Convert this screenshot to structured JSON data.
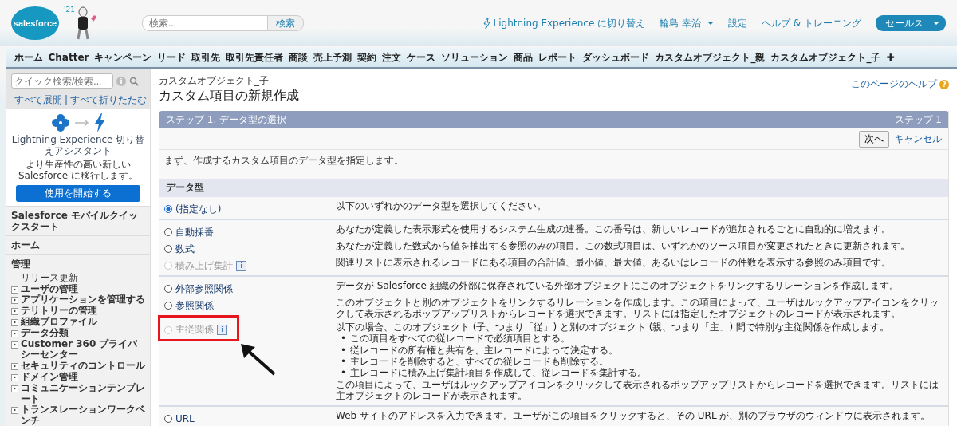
{
  "header": {
    "logo": "salesforce",
    "mascot_year": "'21",
    "search": {
      "placeholder": "検索...",
      "button": "検索"
    },
    "links": [
      {
        "text": "Lightning Experience に切り替え",
        "kind": "lightning"
      },
      {
        "text": "輪島 幸治",
        "kind": "user"
      },
      {
        "text": "設定",
        "kind": "plain"
      },
      {
        "text": "ヘルプ & トレーニング",
        "kind": "plain"
      }
    ],
    "app_menu": "セールス"
  },
  "tabs": [
    {
      "label": "ホーム",
      "selected": false
    },
    {
      "label": "Chatter",
      "selected": false
    },
    {
      "label": "キャンペーン",
      "selected": false
    },
    {
      "label": "リード",
      "selected": false
    },
    {
      "label": "取引先",
      "selected": false
    },
    {
      "label": "取引先責任者",
      "selected": false
    },
    {
      "label": "商談",
      "selected": false
    },
    {
      "label": "売上予測",
      "selected": false
    },
    {
      "label": "契約",
      "selected": false
    },
    {
      "label": "注文",
      "selected": false
    },
    {
      "label": "ケース",
      "selected": false
    },
    {
      "label": "ソリューション",
      "selected": false
    },
    {
      "label": "商品",
      "selected": false
    },
    {
      "label": "レポート",
      "selected": false
    },
    {
      "label": "ダッシュボード",
      "selected": false
    },
    {
      "label": "カスタムオブジェクト_親",
      "selected": false
    },
    {
      "label": "カスタムオブジェクト_子",
      "selected": false
    },
    {
      "label": "✚",
      "selected": false
    }
  ],
  "sidebar": {
    "search": {
      "placeholder": "クイック検索/検索...",
      "info_glyph": "i"
    },
    "separator": "|",
    "expand_all": "すべて展開",
    "collapse_all": "すべて折りたたむ",
    "assistant": {
      "title": "Lightning Experience 切り替えアシスタント",
      "text": "より生産性の高い新しい Salesforce に移行します。",
      "button": "使用を開始する"
    },
    "sections": [
      "Salesforce モバイルクイックスタート",
      "ホーム"
    ],
    "admin": {
      "title": "管理",
      "plain_item": "リリース更新",
      "items": [
        "ユーザの管理",
        "アプリケーションを管理する",
        "テリトリーの管理",
        "組織プロファイル",
        "データ分類",
        "Customer 360 プライバシーセンター",
        "セキュリティのコントロール",
        "ドメイン管理",
        "コミュニケーションテンプレート",
        "トランスレーションワークベンチ"
      ]
    }
  },
  "page": {
    "object": "カスタムオブジェクト_子",
    "title": "カスタム項目の新規作成",
    "help": "このページのヘルプ",
    "help_glyph": "?"
  },
  "step": {
    "title": "ステップ 1. データ型の選択",
    "counter": "ステップ 1",
    "next": "次へ",
    "cancel": "キャンセル",
    "intro": "まず、作成するカスタム項目のデータ型を指定します。",
    "section": "データ型",
    "bullet": "•"
  },
  "groups": [
    {
      "rows": [
        {
          "label": "(指定なし)",
          "selected": true,
          "disabled": false,
          "highlighted": false,
          "description": "以下のいずれかのデータ型を選択してください。"
        }
      ]
    },
    {
      "rows": [
        {
          "label": "自動採番",
          "selected": false,
          "disabled": false,
          "highlighted": false,
          "description": "あなたが定義した表示形式を使用するシステム生成の連番。この番号は、新しいレコードが追加されるごとに自動的に増えます。"
        },
        {
          "label": "数式",
          "selected": false,
          "disabled": false,
          "highlighted": false,
          "description": "あなたが定義した数式から値を抽出する参照のみの項目。この数式項目は、いずれかのソース項目が変更されたときに更新されます。"
        },
        {
          "label": "積み上げ集計",
          "selected": false,
          "disabled": true,
          "info": "i",
          "highlighted": false,
          "description": "関連リストに表示されるレコードにある項目の合計値、最小値、最大値、あるいはレコードの件数を表示する参照のみ項目です。"
        }
      ]
    },
    {
      "rows": [
        {
          "label": "外部参照関係",
          "selected": false,
          "disabled": false,
          "highlighted": false,
          "description": "データが Salesforce 組織の外部に保存されている外部オブジェクトにこのオブジェクトをリンクするリレーションを作成します。"
        },
        {
          "label": "参照関係",
          "selected": false,
          "disabled": false,
          "highlighted": false,
          "description": "このオブジェクトと別のオブジェクトをリンクするリレーションを作成します。この項目によって、ユーザはルックアップアイコンをクリックして表示されるポップアップリストからレコードを選択できます。リストには指定したオブジェクトのレコードが表示されます。"
        },
        {
          "label": "主従関係",
          "selected": false,
          "disabled": true,
          "info": "i",
          "highlighted": true,
          "description": "以下の場合、このオブジェクト (子、つまり「従」) と別のオブジェクト (親、つまり「主」) 間で特別な主従関係を作成します。",
          "bullets": [
            "この項目をすべての従レコードで必須項目とする。",
            "従レコードの所有権と共有を、主レコードによって決定する。",
            "主レコードを削除すると、すべての従レコードも削除する。",
            "主レコードに積み上げ集計項目を作成して、従レコードを集計する。"
          ],
          "note": "この項目によって、ユーザはルックアップアイコンをクリックして表示されるポップアップリストからレコードを選択できます。リストには主オブジェクトのレコードが表示されます。"
        }
      ]
    },
    {
      "rows": [
        {
          "label": "URL",
          "selected": false,
          "disabled": false,
          "highlighted": false,
          "description": "Web サイトのアドレスを入力できます。ユーザがこの項目をクリックすると、その URL が、別のブラウザのウィンドウに表示されます。"
        }
      ]
    }
  ]
}
